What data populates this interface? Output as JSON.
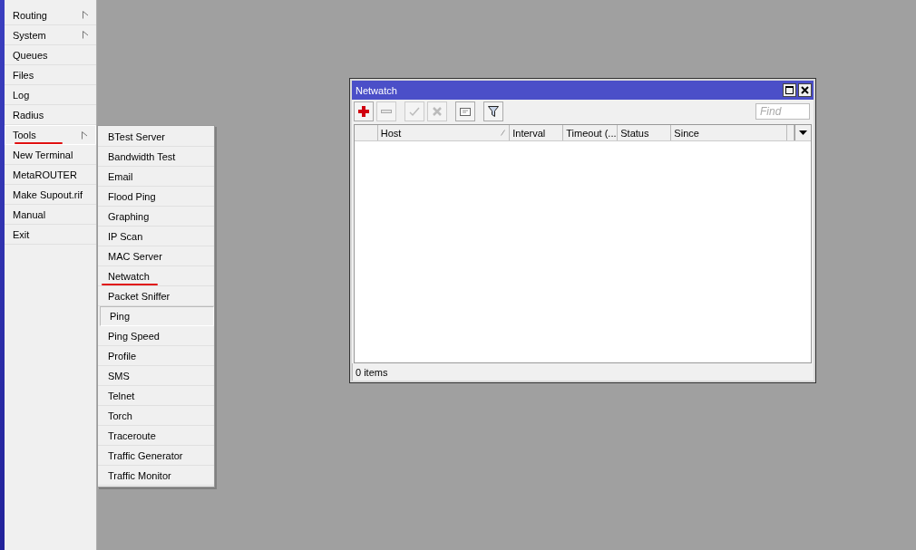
{
  "sidebar": {
    "items": [
      {
        "label": "Routing",
        "has_submenu": true,
        "selected": false,
        "underlined": false
      },
      {
        "label": "System",
        "has_submenu": true,
        "selected": false,
        "underlined": false
      },
      {
        "label": "Queues",
        "has_submenu": false,
        "selected": false,
        "underlined": false
      },
      {
        "label": "Files",
        "has_submenu": false,
        "selected": false,
        "underlined": false
      },
      {
        "label": "Log",
        "has_submenu": false,
        "selected": false,
        "underlined": false
      },
      {
        "label": "Radius",
        "has_submenu": false,
        "selected": false,
        "underlined": false
      },
      {
        "label": "Tools",
        "has_submenu": true,
        "selected": true,
        "underlined": true
      },
      {
        "label": "New Terminal",
        "has_submenu": false,
        "selected": false,
        "underlined": false
      },
      {
        "label": "MetaROUTER",
        "has_submenu": false,
        "selected": false,
        "underlined": false
      },
      {
        "label": "Make Supout.rif",
        "has_submenu": false,
        "selected": false,
        "underlined": false
      },
      {
        "label": "Manual",
        "has_submenu": false,
        "selected": false,
        "underlined": false
      },
      {
        "label": "Exit",
        "has_submenu": false,
        "selected": false,
        "underlined": false
      }
    ]
  },
  "submenu": {
    "items": [
      {
        "label": "BTest Server",
        "selected": false,
        "underlined": false
      },
      {
        "label": "Bandwidth Test",
        "selected": false,
        "underlined": false
      },
      {
        "label": "Email",
        "selected": false,
        "underlined": false
      },
      {
        "label": "Flood Ping",
        "selected": false,
        "underlined": false
      },
      {
        "label": "Graphing",
        "selected": false,
        "underlined": false
      },
      {
        "label": "IP Scan",
        "selected": false,
        "underlined": false
      },
      {
        "label": "MAC Server",
        "selected": false,
        "underlined": false
      },
      {
        "label": "Netwatch",
        "selected": false,
        "underlined": true
      },
      {
        "label": "Packet Sniffer",
        "selected": false,
        "underlined": false
      },
      {
        "label": "Ping",
        "selected": true,
        "underlined": false
      },
      {
        "label": "Ping Speed",
        "selected": false,
        "underlined": false
      },
      {
        "label": "Profile",
        "selected": false,
        "underlined": false
      },
      {
        "label": "SMS",
        "selected": false,
        "underlined": false
      },
      {
        "label": "Telnet",
        "selected": false,
        "underlined": false
      },
      {
        "label": "Torch",
        "selected": false,
        "underlined": false
      },
      {
        "label": "Traceroute",
        "selected": false,
        "underlined": false
      },
      {
        "label": "Traffic Generator",
        "selected": false,
        "underlined": false
      },
      {
        "label": "Traffic Monitor",
        "selected": false,
        "underlined": false
      }
    ]
  },
  "window": {
    "title": "Netwatch",
    "toolbar": [
      {
        "kind": "add",
        "disabled": false
      },
      {
        "kind": "remove",
        "disabled": true
      },
      {
        "kind": "enable",
        "disabled": true
      },
      {
        "kind": "disable",
        "disabled": true
      },
      {
        "kind": "comment",
        "disabled": false
      },
      {
        "kind": "filter",
        "disabled": false
      }
    ],
    "search": {
      "placeholder": "Find"
    },
    "table": {
      "columns": [
        {
          "label": "Host",
          "sortable": true
        },
        {
          "label": "Interval",
          "sortable": false
        },
        {
          "label": "Timeout (...",
          "sortable": false
        },
        {
          "label": "Status",
          "sortable": false
        },
        {
          "label": "Since",
          "sortable": false
        }
      ]
    },
    "status_bar": "0 items"
  }
}
